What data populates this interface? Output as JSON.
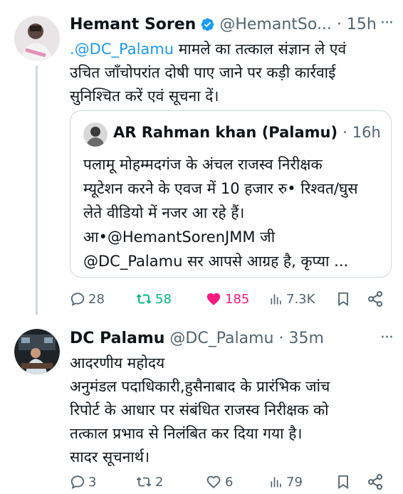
{
  "tweets": [
    {
      "author": "Hemant Soren",
      "handle": "@HemantSo...",
      "separator": "·",
      "time": "15h",
      "more": "···",
      "text_mention": ".@DC_Palamu",
      "text_line1_rest": " मामले का तत्काल संज्ञान ले एवं",
      "text_line2": "उचित जाँचोपरांत दोषी पाए जाने पर कड़ी कार्रवाई",
      "text_line3": "सुनिश्चित करें एवं सूचना दें।",
      "quote": {
        "author": "AR Rahman khan (Palamu)",
        "separator": "·",
        "time": "16h",
        "lines": [
          "पलामू मोहम्मदगंज के अंचल राजस्व निरीक्षक",
          "म्यूटेशन करने के एवज में 10 हजार रु• रिश्वत/घुस",
          "लेते वीडियो में नजर आ रहे हैं।",
          "आ•@HemantSorenJMM जी",
          "@DC_Palamu सर आपसे आग्रह है, कृप्या  ..."
        ]
      },
      "stats": {
        "replies": "28",
        "reposts": "58",
        "likes": "185",
        "views": "7.3K"
      }
    },
    {
      "author": "DC Palamu",
      "handle": "@DC_Palamu",
      "separator": "·",
      "time": "35m",
      "more": "···",
      "lines": [
        "आदरणीय महोदय",
        "अनुमंडल पदाधिकारी,हुसैनाबाद के प्रारंभिक जांच",
        "रिपोर्ट के आधार पर संबंधित राजस्व निरीक्षक को",
        "तत्काल प्रभाव से निलंबित कर दिया गया है।",
        "सादर सूचनार्थ।"
      ],
      "stats": {
        "replies": "3",
        "reposts": "2",
        "likes": "6",
        "views": "79"
      }
    }
  ],
  "colors": {
    "accent": "#1d9bf0",
    "repost_active": "#00ba7c",
    "like_active": "#f91880",
    "muted": "#536471"
  }
}
